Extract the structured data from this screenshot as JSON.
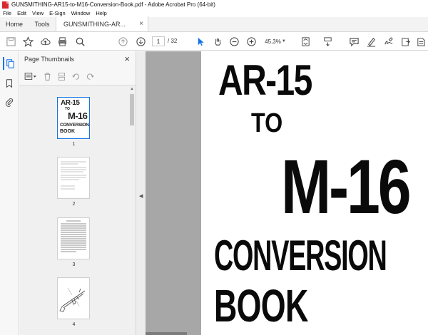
{
  "window": {
    "title": "GUNSMITHING-AR15-to-M16-Conversion-Book.pdf - Adobe Acrobat Pro (64-bit)"
  },
  "menu": [
    "File",
    "Edit",
    "View",
    "E-Sign",
    "Window",
    "Help"
  ],
  "tabs": {
    "home": "Home",
    "tools": "Tools",
    "document": "GUNSMITHING-AR...",
    "close_glyph": "×"
  },
  "toolbar": {
    "current_page": "1",
    "total_pages": "/ 32",
    "zoom": "45,3%"
  },
  "panel": {
    "title": "Page Thumbnails",
    "close_glyph": "×",
    "thumbnails": [
      {
        "number": "1",
        "lines": [
          "AR-15",
          "TO",
          "M-16",
          "CONVERSION",
          "BOOK"
        ]
      },
      {
        "number": "2"
      },
      {
        "number": "3"
      },
      {
        "number": "4"
      }
    ]
  },
  "page": {
    "line1": "AR-15",
    "line2": "TO",
    "line3": "M-16",
    "line4": "CONVERSION",
    "line5": "BOOK"
  },
  "colors": {
    "accent": "#1473e6",
    "app_red": "#d7282f",
    "doc_bg": "#a7a7a7"
  }
}
